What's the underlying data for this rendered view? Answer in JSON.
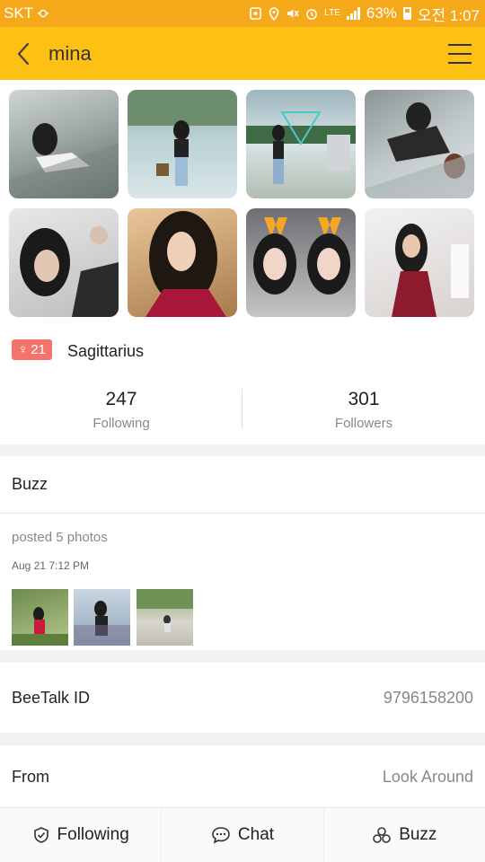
{
  "status_bar": {
    "carrier": "SKT",
    "battery": "63%",
    "clock": "오전 1:07",
    "network": "LTE"
  },
  "header": {
    "title": "mina"
  },
  "profile": {
    "gender_symbol": "♀",
    "age": "21",
    "zodiac": "Sagittarius",
    "following_count": "247",
    "following_label": "Following",
    "followers_count": "301",
    "followers_label": "Followers"
  },
  "buzz": {
    "title": "Buzz",
    "posted_text": "posted 5 photos",
    "timestamp": "Aug 21 7:12 PM"
  },
  "beetalk_id": {
    "label": "BeeTalk ID",
    "value": "9796158200"
  },
  "from": {
    "label": "From",
    "value": "Look Around"
  },
  "bottom_tabs": [
    {
      "label": "Following",
      "icon": "shield-check-icon"
    },
    {
      "label": "Chat",
      "icon": "chat-bubble-icon"
    },
    {
      "label": "Buzz",
      "icon": "three-circles-icon"
    }
  ],
  "colors": {
    "status_bar": "#f6a81b",
    "app_bar": "#fec113",
    "badge": "#f4736b"
  }
}
